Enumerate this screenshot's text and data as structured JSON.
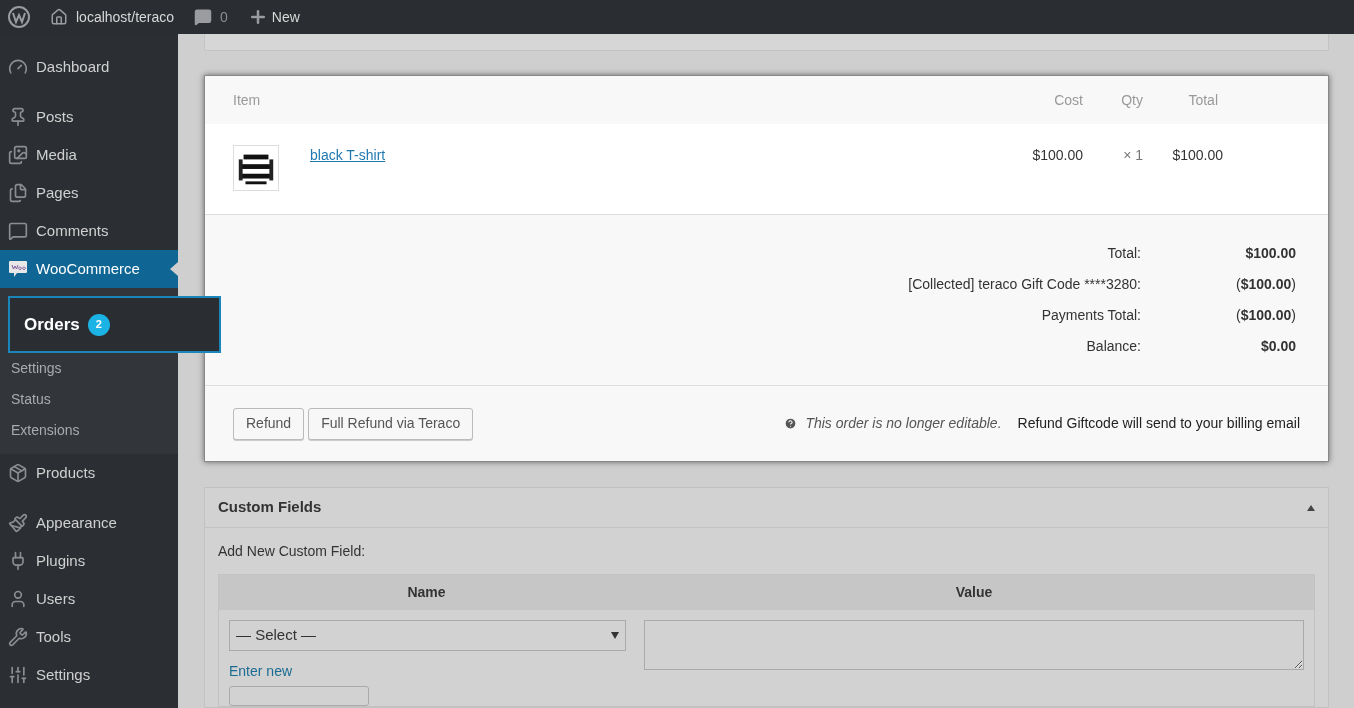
{
  "top_bar": {
    "site": "localhost/teraco",
    "comments": "0",
    "new": "New"
  },
  "sidebar": {
    "items": [
      {
        "kind": "dashboard",
        "label": "Dashboard",
        "selected": false
      },
      {
        "kind": "posts",
        "label": "Posts",
        "selected": false
      },
      {
        "kind": "media",
        "label": "Media",
        "selected": false
      },
      {
        "kind": "pages",
        "label": "Pages",
        "selected": false
      },
      {
        "kind": "comments",
        "label": "Comments",
        "selected": false
      },
      {
        "kind": "woo",
        "label": "WooCommerce",
        "selected": true,
        "children": [
          {
            "label": "Orders",
            "badge": "2",
            "selected": true
          },
          {
            "label": "Settings",
            "selected": false
          },
          {
            "label": "Status",
            "selected": false
          },
          {
            "label": "Extensions",
            "selected": false
          }
        ]
      },
      {
        "kind": "products",
        "label": "Products",
        "selected": false
      },
      {
        "kind": "appearance",
        "label": "Appearance",
        "selected": false
      },
      {
        "kind": "plugins",
        "label": "Plugins",
        "selected": false
      },
      {
        "kind": "users",
        "label": "Users",
        "selected": false
      },
      {
        "kind": "tools",
        "label": "Tools",
        "selected": false
      },
      {
        "kind": "settings",
        "label": "Settings",
        "selected": false
      }
    ]
  },
  "order_items": {
    "columns": [
      "Item",
      "Cost",
      "Qty",
      "Total"
    ],
    "rows": [
      {
        "kind": "picture",
        "name": "black T-shirt",
        "cost": "$100.00",
        "qty": "× 1",
        "total": "$100.00"
      }
    ],
    "totals": [
      {
        "label": "Total:",
        "value": "**$100.00**"
      },
      {
        "label": "[Collected] teraco Gift Code ****3280:",
        "value": "(**$100.00**)"
      },
      {
        "label": "Payments Total:",
        "value": "(**$100.00**)"
      },
      {
        "label": "Balance:",
        "value": "**$0.00**"
      }
    ],
    "buttons": [
      "Refund",
      "Full Refund via Teraco"
    ],
    "notice": "This order is no longer editable.",
    "message": "Refund Giftcode will send to your billing email"
  },
  "custom_fields": {
    "title": "Custom Fields",
    "expanded": true,
    "add_label": "Add New Custom Field:",
    "columns": [
      "Name",
      "Value"
    ],
    "select": "— Select —",
    "link": "Enter new"
  }
}
